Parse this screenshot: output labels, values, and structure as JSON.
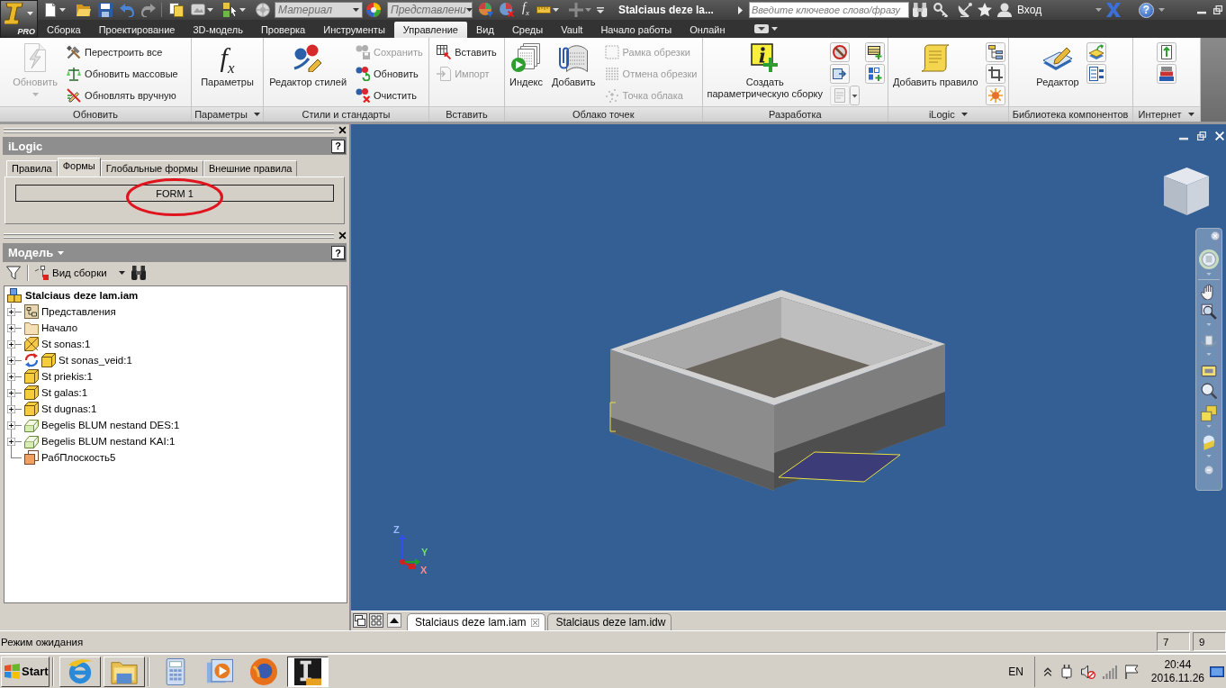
{
  "app_button": {
    "badge": "PRO"
  },
  "quick_access": {
    "formula": "f$_{x}$",
    "material": {
      "value": "Материал",
      "disabled": true
    },
    "appearance": {
      "value": "Представлени",
      "disabled": true
    }
  },
  "title": "Stalciaus deze la...",
  "search": {
    "placeholder": "Введите ключевое слово/фразу"
  },
  "sign_in": "Вход",
  "help": "?",
  "ribbon_tabs": [
    {
      "label": "Сборка",
      "selected": false
    },
    {
      "label": "Проектирование",
      "selected": false
    },
    {
      "label": "3D-модель",
      "selected": false
    },
    {
      "label": "Проверка",
      "selected": false
    },
    {
      "label": "Инструменты",
      "selected": false
    },
    {
      "label": "Управление",
      "selected": true
    },
    {
      "label": "Вид",
      "selected": false
    },
    {
      "label": "Среды",
      "selected": false
    },
    {
      "label": "Vault",
      "selected": false
    },
    {
      "label": "Начало работы",
      "selected": false
    },
    {
      "label": "Онлайн",
      "selected": false
    }
  ],
  "ribbon_panels": [
    {
      "title": "Обновить",
      "menu": false,
      "items": [
        {
          "kind": "large",
          "label": "Обновить",
          "disabled": true,
          "caret": true
        },
        {
          "kind": "small",
          "label": "Перестроить все",
          "disabled": false,
          "caret": false
        },
        {
          "kind": "small",
          "label": "Обновить массовые",
          "disabled": false,
          "caret": false
        },
        {
          "kind": "small",
          "label": "Обновлять вручную",
          "disabled": false,
          "caret": false
        }
      ]
    },
    {
      "title": "Параметры",
      "menu": true,
      "items": [
        {
          "kind": "symbol",
          "symbol": "f$_{x}$",
          "label": "Параметры",
          "disabled": false,
          "caret": false
        }
      ]
    },
    {
      "title": "Стили и стандарты",
      "menu": false,
      "items": [
        {
          "kind": "large",
          "label": "Редактор стилей",
          "disabled": false,
          "caret": false
        },
        {
          "kind": "small",
          "label": "Сохранить",
          "disabled": true,
          "caret": false
        },
        {
          "kind": "small",
          "label": "Обновить",
          "disabled": false,
          "caret": false
        },
        {
          "kind": "small",
          "label": "Очистить",
          "disabled": false,
          "caret": false
        }
      ]
    },
    {
      "title": "Вставить",
      "menu": false,
      "items": [
        {
          "kind": "small",
          "label": "Вставить",
          "disabled": false,
          "caret": false
        },
        {
          "kind": "small",
          "label": "Импорт",
          "disabled": true,
          "caret": false
        }
      ]
    },
    {
      "title": "Облако точек",
      "menu": false,
      "items": [
        {
          "kind": "large",
          "label": "Индекс",
          "disabled": false,
          "caret": false
        },
        {
          "kind": "large",
          "label": "Добавить",
          "disabled": false,
          "caret": false
        },
        {
          "kind": "small",
          "label": "Рамка обрезки",
          "disabled": true,
          "caret": false
        },
        {
          "kind": "small",
          "label": "Отмена обрезки",
          "disabled": true,
          "caret": false
        },
        {
          "kind": "small",
          "label": "Точка облака",
          "disabled": true,
          "caret": false
        }
      ]
    },
    {
      "title": "Разработка",
      "menu": false,
      "items": [
        {
          "kind": "large",
          "label": "Создать\nпараметрическую сборку",
          "disabled": false,
          "caret": false
        },
        {
          "kind": "icon",
          "disabled": false,
          "caret": false
        },
        {
          "kind": "icon",
          "disabled": false,
          "caret": false
        },
        {
          "kind": "icon",
          "disabled": true,
          "caret": true
        },
        {
          "kind": "icon",
          "disabled": false,
          "caret": false
        },
        {
          "kind": "icon",
          "disabled": false,
          "caret": false
        }
      ]
    },
    {
      "title": "iLogic",
      "menu": true,
      "items": [
        {
          "kind": "large",
          "label": "Добавить правило",
          "disabled": false,
          "caret": false
        },
        {
          "kind": "icon",
          "disabled": false,
          "caret": false
        },
        {
          "kind": "icon",
          "disabled": false,
          "caret": false
        },
        {
          "kind": "icon",
          "disabled": false,
          "caret": false
        }
      ]
    },
    {
      "title": "Библиотека компонентов",
      "menu": false,
      "items": [
        {
          "kind": "large",
          "label": "Редактор",
          "disabled": false,
          "caret": false
        },
        {
          "kind": "icon",
          "disabled": false,
          "caret": false
        },
        {
          "kind": "icon",
          "disabled": false,
          "caret": false
        }
      ]
    },
    {
      "title": "Интернет",
      "menu": true,
      "items": [
        {
          "kind": "icon",
          "disabled": false,
          "caret": false
        },
        {
          "kind": "icon",
          "disabled": false,
          "caret": false
        }
      ]
    }
  ],
  "ilogic_panel": {
    "title": "iLogic",
    "help": "?",
    "tabs": [
      {
        "label": "Правила",
        "selected": false
      },
      {
        "label": "Формы",
        "selected": true
      },
      {
        "label": "Глобальные формы",
        "selected": false
      },
      {
        "label": "Внешние правила",
        "selected": false
      }
    ],
    "forms": [
      {
        "label": "FORM 1",
        "circled": true
      }
    ]
  },
  "model_panel": {
    "title": "Модель",
    "help": "?",
    "view": "Вид сборки",
    "tree": [
      {
        "label": "Stalciaus deze lam.iam",
        "kind": "assembly",
        "adaptive": false,
        "children": [
          {
            "label": "Представления",
            "kind": "representations",
            "expanded": false,
            "adaptive": false
          },
          {
            "label": "Начало",
            "kind": "folder",
            "expanded": false,
            "adaptive": false
          },
          {
            "label": "St sonas:1",
            "kind": "pattern",
            "expanded": false,
            "adaptive": false
          },
          {
            "label": "St sonas_veid:1",
            "kind": "part",
            "expanded": false,
            "adaptive": true
          },
          {
            "label": "St priekis:1",
            "kind": "part",
            "expanded": false,
            "adaptive": false
          },
          {
            "label": "St galas:1",
            "kind": "part",
            "expanded": false,
            "adaptive": false
          },
          {
            "label": "St dugnas:1",
            "kind": "part",
            "expanded": false,
            "adaptive": false
          },
          {
            "label": "Begelis BLUM nestand DES:1",
            "kind": "component",
            "expanded": false,
            "adaptive": false
          },
          {
            "label": "Begelis BLUM nestand KAI:1",
            "kind": "component",
            "expanded": false,
            "adaptive": false
          },
          {
            "label": "РабПлоскость5",
            "kind": "plane",
            "adaptive": false
          }
        ]
      }
    ]
  },
  "viewport": {
    "axis_labels": [
      "Z",
      "Y",
      "X"
    ]
  },
  "document_tabs": [
    {
      "label": "Stalciaus deze lam.iam",
      "selected": true
    },
    {
      "label": "Stalciaus deze lam.idw",
      "selected": false
    }
  ],
  "status_bar": {
    "message": "Режим ожидания",
    "fields": [
      "7",
      "9"
    ]
  },
  "taskbar": {
    "start": "Start",
    "apps": [
      {
        "kind": "window",
        "selected": false
      },
      {
        "kind": "window",
        "selected": false
      },
      {
        "kind": "launcher",
        "selected": false
      },
      {
        "kind": "launcher",
        "selected": false
      },
      {
        "kind": "launcher",
        "selected": false
      },
      {
        "kind": "window",
        "selected": true
      }
    ],
    "language": "EN",
    "time": "20:44",
    "date": "2016.11.26"
  }
}
